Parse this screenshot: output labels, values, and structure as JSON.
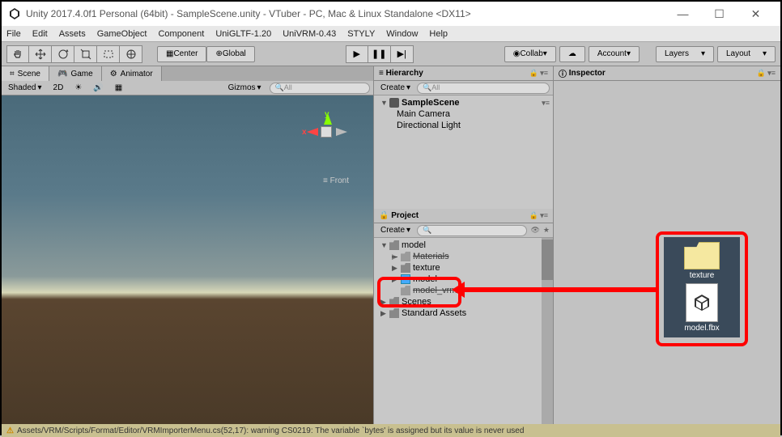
{
  "title": "Unity 2017.4.0f1 Personal (64bit) - SampleScene.unity - VTuber - PC, Mac & Linux Standalone <DX11>",
  "menu": [
    "File",
    "Edit",
    "Assets",
    "GameObject",
    "Component",
    "UniGLTF-1.20",
    "UniVRM-0.43",
    "STYLY",
    "Window",
    "Help"
  ],
  "toolbar": {
    "center": "Center",
    "global": "Global",
    "collab": "Collab",
    "account": "Account",
    "layers": "Layers",
    "layout": "Layout"
  },
  "scene_tabs": {
    "scene": "Scene",
    "game": "Game",
    "animator": "Animator"
  },
  "shade": {
    "mode": "Shaded",
    "d2": "2D",
    "gizmos": "Gizmos",
    "all": "All"
  },
  "gizmo": {
    "x": "x",
    "y": "y",
    "front": "≡ Front"
  },
  "hierarchy": {
    "title": "Hierarchy",
    "create": "Create",
    "search": "All",
    "scene": "SampleScene",
    "items": [
      "Main Camera",
      "Directional Light"
    ]
  },
  "project": {
    "title": "Project",
    "create": "Create",
    "root": "model",
    "items": [
      {
        "name": "Materials",
        "icon": "folder"
      },
      {
        "name": "texture",
        "icon": "folder"
      },
      {
        "name": "model",
        "icon": "cube"
      },
      {
        "name": "model_vrm",
        "icon": "folder",
        "strike": true
      },
      {
        "name": "Scenes",
        "icon": "folder"
      },
      {
        "name": "Standard Assets",
        "icon": "folder"
      }
    ]
  },
  "inspector": {
    "title": "Inspector"
  },
  "files": {
    "texture": "texture",
    "model": "model.fbx"
  },
  "status": "Assets/VRM/Scripts/Format/Editor/VRMImporterMenu.cs(52,17): warning CS0219: The variable `bytes' is assigned but its value is never used"
}
